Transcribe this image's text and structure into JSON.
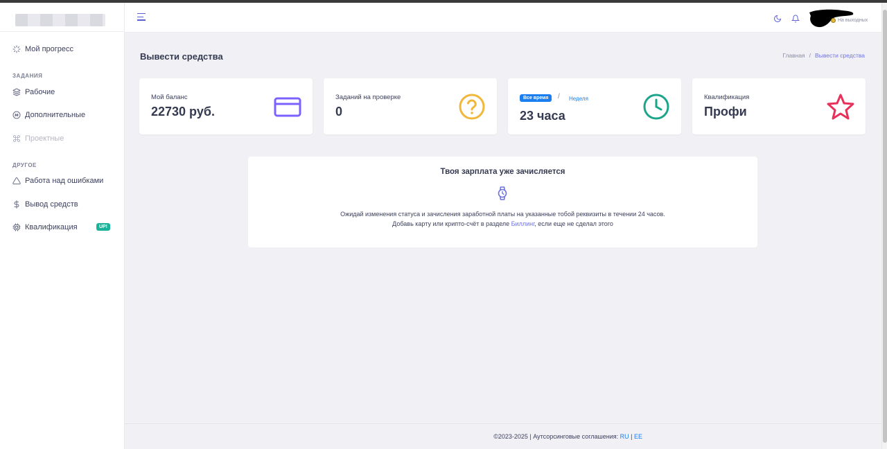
{
  "sidebar": {
    "items": [
      {
        "label": "Мой прогресс",
        "icon": "loader-icon"
      },
      {
        "label": "Рабочие",
        "icon": "layers-icon"
      },
      {
        "label": "Дополнительные",
        "icon": "hash-icon"
      },
      {
        "label": "Проектные",
        "icon": "command-icon"
      },
      {
        "label": "Работа над ошибками",
        "icon": "warning-icon"
      },
      {
        "label": "Вывод средств",
        "icon": "dollar-icon"
      },
      {
        "label": "Квалификация",
        "icon": "chip-icon",
        "badge": "UP!"
      }
    ],
    "sections": [
      "ЗАДАНИЯ",
      "ДРУГОЕ"
    ]
  },
  "header": {
    "status_label": "На выходных"
  },
  "page": {
    "title": "Вывести средства",
    "breadcrumb_home": "Главная",
    "breadcrumb_sep": "/",
    "breadcrumb_current": "Вывести средства"
  },
  "cards": {
    "balance_label": "Мой баланс",
    "balance_value": "22730 руб.",
    "review_label": "Заданий на проверке",
    "review_value": "0",
    "time_pill": "Все время",
    "time_sep": "/",
    "time_week": "Неделя",
    "time_value": "23 часа",
    "qual_label": "Квалификация",
    "qual_value": "Профи"
  },
  "notice": {
    "title": "Твоя зарплата уже зачисляется",
    "line1": "Ожидай изменения статуса и зачисления заработной платы на указанные тобой реквизиты в течении 24 часов.",
    "line2_before": "Добавь карту или крипто-счёт в разделе ",
    "line2_link": "Биллинг",
    "line2_after": ", если еще не сделал этого"
  },
  "footer": {
    "text": "©2023-2025 | Аутсорсинговые соглашения: ",
    "ru": "RU",
    "sep": " | ",
    "ee": "EE"
  },
  "colors": {
    "accent": "#6f74e0",
    "card_icon_purple": "#7b61ff",
    "card_icon_yellow": "#f0b73a",
    "card_icon_teal": "#1ba58a",
    "card_icon_red": "#e8315a",
    "link_blue": "#1a7ef0",
    "badge_green": "#1ab39a"
  }
}
